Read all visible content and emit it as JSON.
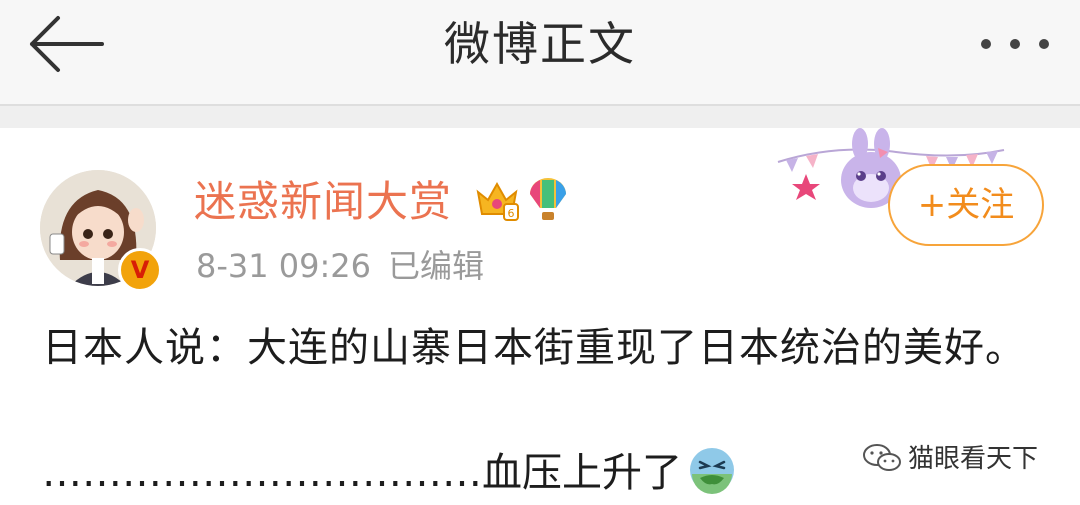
{
  "header": {
    "title": "微博正文",
    "back_icon": "back-arrow-icon",
    "more_icon": "more-dots-icon"
  },
  "post": {
    "author": "迷惑新闻大赏",
    "timestamp": "8-31 09:26",
    "edited_label": "已编辑",
    "follow_label": "+关注",
    "verified_badge": "V",
    "body_text": "日本人说：大连的山寨日本街重现了日本统治的美好。",
    "line3_text": "……………………………血压上升了",
    "colors": {
      "author": "#eb7350",
      "follow": "#f28c1c",
      "meta": "#9a9a9a"
    }
  },
  "watermark": {
    "text": "猫眼看天下"
  }
}
